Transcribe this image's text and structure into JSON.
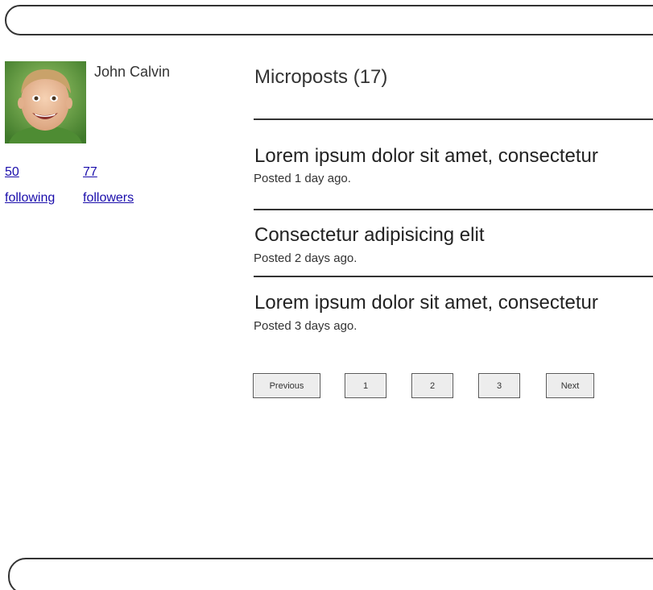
{
  "user": {
    "name": "John Calvin",
    "following_count": "50",
    "following_label": "following",
    "followers_count": "77",
    "followers_label": "followers"
  },
  "feed": {
    "title": "Microposts (17)",
    "posts": [
      {
        "content": "Lorem ipsum dolor sit amet, consectetur",
        "meta": "Posted 1 day ago."
      },
      {
        "content": "Consectetur adipisicing elit",
        "meta": "Posted 2 days ago."
      },
      {
        "content": "Lorem ipsum dolor sit amet, consectetur",
        "meta": "Posted 3 days ago."
      }
    ]
  },
  "pagination": {
    "previous": "Previous",
    "pages": [
      "1",
      "2",
      "3"
    ],
    "next": "Next"
  },
  "colors": {
    "link": "#1a0dab",
    "border": "#333333",
    "button_bg": "#ededed"
  },
  "icons": {
    "avatar": "user-avatar-photo"
  }
}
